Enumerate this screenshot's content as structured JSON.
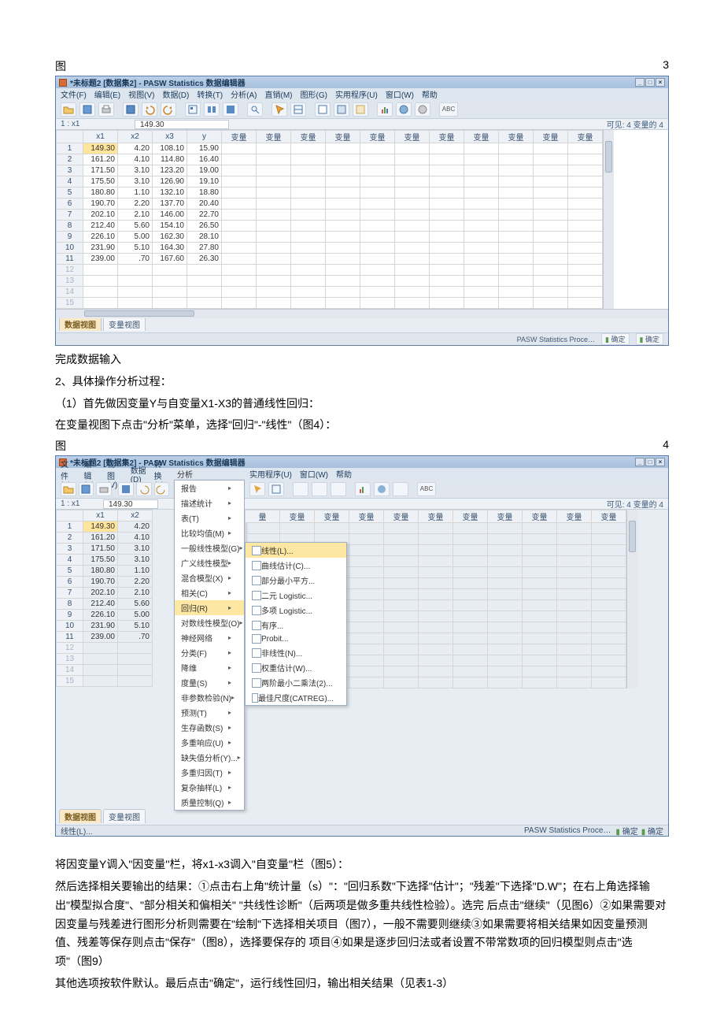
{
  "captions": {
    "fig3_left": "图",
    "fig3_right": "3",
    "fig4_left": "图",
    "fig4_right": "4"
  },
  "app": {
    "title": "*未标题2 [数据集2] - PASW Statistics 数据编辑器",
    "menus": [
      "文件(F)",
      "编辑(E)",
      "视图(V)",
      "数据(D)",
      "转换(T)",
      "分析(A)",
      "直销(M)",
      "图形(G)",
      "实用程序(U)",
      "窗口(W)",
      "帮助"
    ],
    "cell_ref": "1 : x1",
    "cell_val": "149.30",
    "vis_info": "可见: 4 变量的 4",
    "columns": [
      "x1",
      "x2",
      "x3",
      "y",
      "变量",
      "变量",
      "变量",
      "变量",
      "变量",
      "变量",
      "变量",
      "变量",
      "变量",
      "变量",
      "变量"
    ],
    "rows": [
      [
        "149.30",
        "4.20",
        "108.10",
        "15.90"
      ],
      [
        "161.20",
        "4.10",
        "114.80",
        "16.40"
      ],
      [
        "171.50",
        "3.10",
        "123.20",
        "19.00"
      ],
      [
        "175.50",
        "3.10",
        "126.90",
        "19.10"
      ],
      [
        "180.80",
        "1.10",
        "132.10",
        "18.80"
      ],
      [
        "190.70",
        "2.20",
        "137.70",
        "20.40"
      ],
      [
        "202.10",
        "2.10",
        "146.00",
        "22.70"
      ],
      [
        "212.40",
        "5.60",
        "154.10",
        "26.50"
      ],
      [
        "226.10",
        "5.00",
        "162.30",
        "28.10"
      ],
      [
        "231.90",
        "5.10",
        "164.30",
        "27.80"
      ],
      [
        "239.00",
        ".70",
        "167.60",
        "26.30"
      ]
    ],
    "empty_rows": [
      "12",
      "13",
      "14",
      "15"
    ],
    "tabs": {
      "data": "数据视图",
      "var": "变量视图"
    },
    "status": {
      "proc": "PASW Statistics Proce…",
      "ok1": "确定",
      "ok2": "确定"
    },
    "wincontrols": {
      "min": "_",
      "max": "□",
      "close": "×"
    }
  },
  "app2": {
    "menus_left": [
      "文件(F)",
      "编辑(E)",
      "视图(V)",
      "数据(D)",
      "转换(T)"
    ],
    "analysis_label": "分析",
    "menus_right": [
      "实用程序(U)",
      "窗口(W)",
      "帮助"
    ],
    "cell_ref": "1 : x1",
    "cell_val": "149.30",
    "columns_left": [
      "x1",
      "x2"
    ],
    "columns_right": [
      "量",
      "变量",
      "变量",
      "变量",
      "变量",
      "变量",
      "变量",
      "变量",
      "变量",
      "变量",
      "变量"
    ],
    "rows2": [
      [
        "149.30",
        "4.20"
      ],
      [
        "161.20",
        "4.10"
      ],
      [
        "171.50",
        "3.10"
      ],
      [
        "175.50",
        "3.10"
      ],
      [
        "180.80",
        "1.10"
      ],
      [
        "190.70",
        "2.20"
      ],
      [
        "202.10",
        "2.10"
      ],
      [
        "212.40",
        "5.60"
      ],
      [
        "226.10",
        "5.00"
      ],
      [
        "231.90",
        "5.10"
      ],
      [
        "239.00",
        ".70"
      ]
    ],
    "dropdown": [
      "报告",
      "描述统计",
      "表(T)",
      "比较均值(M)",
      "一般线性模型(G)",
      "广义线性模型",
      "混合模型(X)",
      "相关(C)",
      "回归(R)",
      "对数线性模型(O)",
      "神经网络",
      "分类(F)",
      "降维",
      "度量(S)",
      "非参数检验(N)",
      "预测(T)",
      "生存函数(S)",
      "多重响应(U)",
      "缺失值分析(Y)...",
      "多重归因(T)",
      "复杂抽样(L)",
      "质量控制(Q)"
    ],
    "hl_index": 8,
    "submenu": [
      "线性(L)...",
      "曲线估计(C)...",
      "部分最小平方...",
      "二元 Logistic...",
      "多项 Logistic...",
      "有序...",
      "Probit...",
      "非线性(N)...",
      "权重估计(W)...",
      "两阶最小二乘法(2)...",
      "最佳尺度(CATREG)..."
    ],
    "sub_hl_index": 0,
    "bottom_extra": "线性(L)...",
    "tabs": {
      "data": "数据视图",
      "var": "变量视图"
    }
  },
  "text": {
    "p1": "完成数据输入",
    "p2": "2、具体操作分析过程：",
    "p3": "（1）首先做因变量Y与自变量X1-X3的普通线性回归：",
    "p4": "在变量视图下点击\"分析\"菜单，选择\"回归\"-\"线性\"（图4）：",
    "p5": "将因变量Y调入\"因变量''栏，将x1-x3调入\"自变量''栏（图5）：",
    "p6": "然后选择相关要输出的结果：①点击右上角\"统计量（s）\"：\"回归系数\"下选择\"估计\"；\"残差\"下选择\"D.W\"；在右上角选择输出\"模型拟合度\"、\"部分相关和偏相关\" \"共线性诊断\"（后两项是做多重共线性检验）。选完 后点击\"继续\"（见图6）②如果需要对因变量与残差进行图形分析则需要在\"绘制\"下选择相关项目（图7），一般不需要则继续③如果需要将相关结果如因变量预测值、残差等保存则点击\"保存\"（图8），选择要保存的 项目④如果是逐步回归法或者设置不带常数项的回归模型则点击\"选项\"（图9）",
    "p7": "其他选项按软件默认。最后点击\"确定\"，运行线性回归，输出相关结果（见表1-3）"
  }
}
